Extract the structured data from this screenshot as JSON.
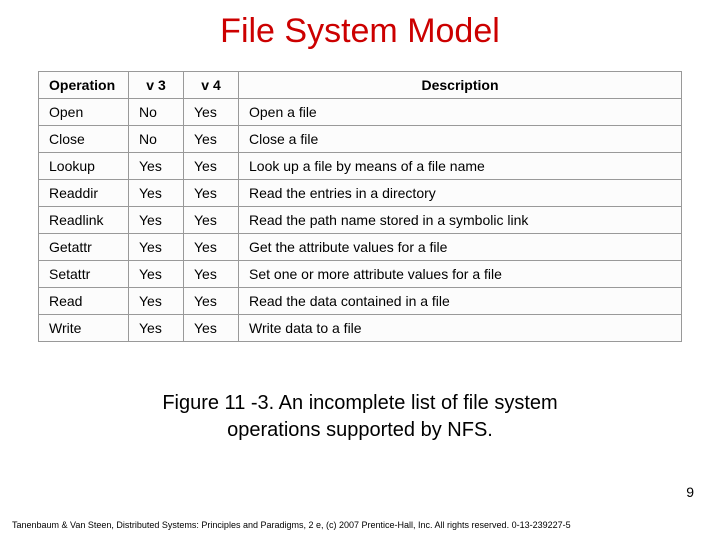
{
  "title": "File System Model",
  "table": {
    "headers": {
      "operation": "Operation",
      "v3": "v 3",
      "v4": "v 4",
      "description": "Description"
    },
    "rows": [
      {
        "op": "Open",
        "v3": "No",
        "v4": "Yes",
        "desc": "Open a file"
      },
      {
        "op": "Close",
        "v3": "No",
        "v4": "Yes",
        "desc": "Close a file"
      },
      {
        "op": "Lookup",
        "v3": "Yes",
        "v4": "Yes",
        "desc": "Look up a file by means of a file name"
      },
      {
        "op": "Readdir",
        "v3": "Yes",
        "v4": "Yes",
        "desc": "Read the entries in a directory"
      },
      {
        "op": "Readlink",
        "v3": "Yes",
        "v4": "Yes",
        "desc": "Read the path name stored in a symbolic link"
      },
      {
        "op": "Getattr",
        "v3": "Yes",
        "v4": "Yes",
        "desc": "Get the attribute values for a file"
      },
      {
        "op": "Setattr",
        "v3": "Yes",
        "v4": "Yes",
        "desc": "Set one or more attribute values for a file"
      },
      {
        "op": "Read",
        "v3": "Yes",
        "v4": "Yes",
        "desc": "Read the data contained in a file"
      },
      {
        "op": "Write",
        "v3": "Yes",
        "v4": "Yes",
        "desc": "Write data to a file"
      }
    ]
  },
  "caption_line1": "Figure 11 -3. An incomplete list of file system",
  "caption_line2": "operations supported by NFS.",
  "page_number": "9",
  "footer": "Tanenbaum & Van Steen, Distributed Systems: Principles and Paradigms, 2 e, (c) 2007 Prentice-Hall, Inc. All rights reserved. 0-13-239227-5"
}
